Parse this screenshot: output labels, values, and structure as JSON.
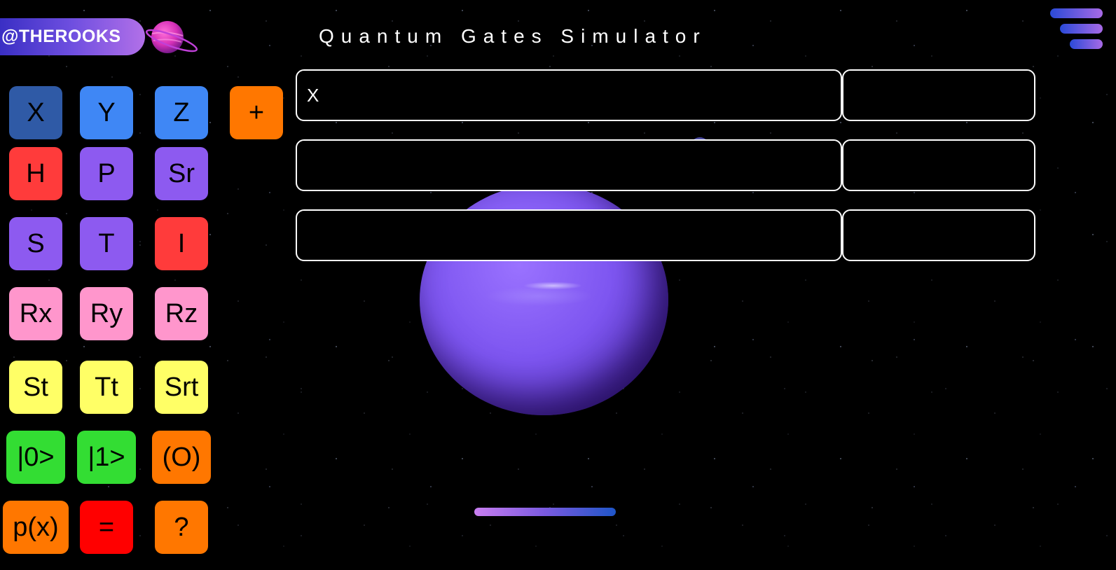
{
  "brand": {
    "label": "@THEROOKS"
  },
  "title": "Quantum Gates Simulator",
  "gates": [
    {
      "label": "X",
      "color": "#2f5aa6"
    },
    {
      "label": "Y",
      "color": "#3f87f5"
    },
    {
      "label": "Z",
      "color": "#3f87f5"
    },
    {
      "label": "+",
      "color": "#ff7700"
    },
    {
      "label": "H",
      "color": "#ff3b3b"
    },
    {
      "label": "P",
      "color": "#8d5af0"
    },
    {
      "label": "Sr",
      "color": "#8d5af0"
    },
    {
      "label": "S",
      "color": "#8d5af0"
    },
    {
      "label": "T",
      "color": "#8d5af0"
    },
    {
      "label": "I",
      "color": "#ff3b3b"
    },
    {
      "label": "Rx",
      "color": "#ff96cc"
    },
    {
      "label": "Ry",
      "color": "#ff96cc"
    },
    {
      "label": "Rz",
      "color": "#ff96cc"
    },
    {
      "label": "St",
      "color": "#ffff66"
    },
    {
      "label": "Tt",
      "color": "#ffff66"
    },
    {
      "label": "Srt",
      "color": "#ffff66"
    },
    {
      "label": "|0>",
      "color": "#33dd33"
    },
    {
      "label": "|1>",
      "color": "#33dd33"
    },
    {
      "label": "(O)",
      "color": "#ff7700"
    },
    {
      "label": "p(x)",
      "color": "#ff7700"
    },
    {
      "label": "=",
      "color": "#ff0000"
    },
    {
      "label": "?",
      "color": "#ff7700"
    }
  ],
  "rows": [
    {
      "gate_sequence": "X",
      "result": ""
    },
    {
      "gate_sequence": "",
      "result": ""
    },
    {
      "gate_sequence": "",
      "result": ""
    }
  ],
  "icons": {
    "logo": "planet-icon",
    "menu": "hamburger-menu-icon"
  },
  "accent": "#7a5ae0"
}
